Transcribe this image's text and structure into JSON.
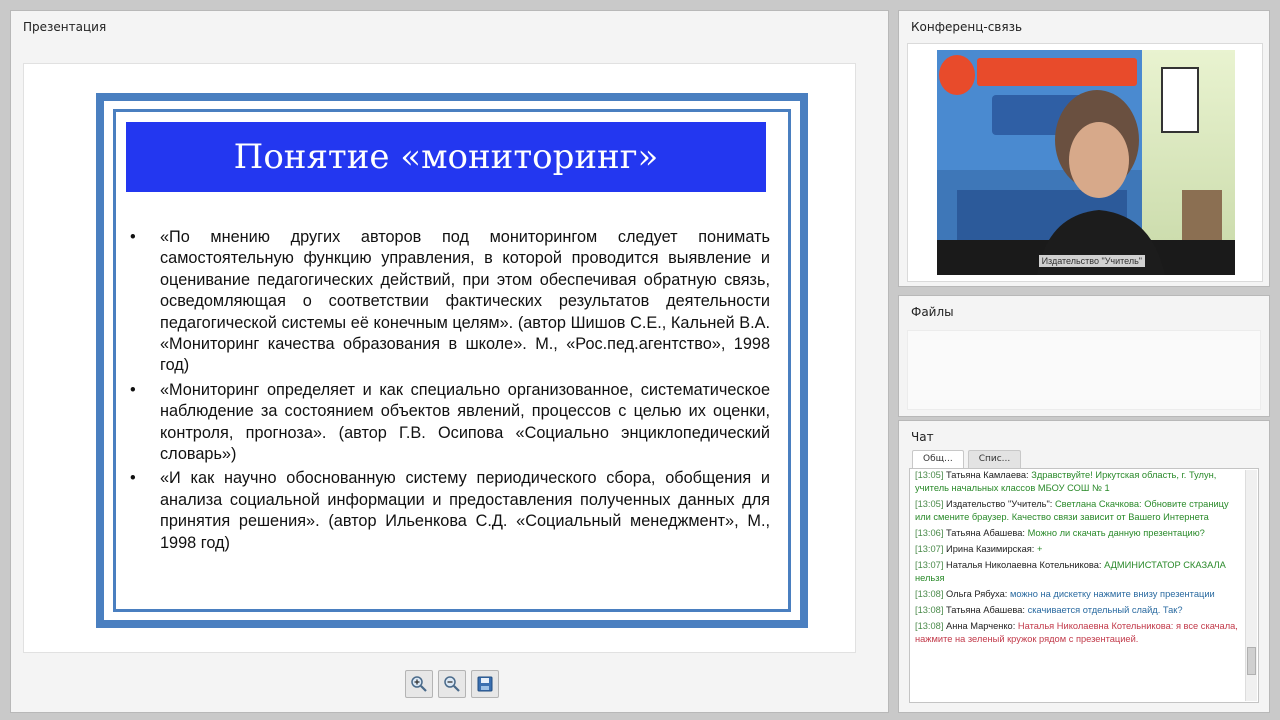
{
  "presentation": {
    "title": "Презентация",
    "slide": {
      "heading": "Понятие «мониторинг»",
      "bullets": [
        "«По мнению других авторов под мониторингом следует понимать самостоятельную функцию управления, в которой проводится выявление и оценивание педагогических действий, при этом обеспечивая обратную связь, осведомляющая о соответствии фактических результатов деятельности педагогической системы её конечным целям». (автор Шишов С.Е., Кальней В.А. «Мониторинг качества образования в школе». М., «Рос.пед.агентство», 1998 год)",
        "«Мониторинг определяет и как специально организованное, систематическое наблюдение за состоянием объектов явлений, процессов с целью их оценки, контроля, прогноза». (автор Г.В. Осипова «Социально энциклопедический словарь»)",
        "«И как научно обоснованную систему периодического сбора, обобщения и анализа социальной информации и предоставления полученных данных для принятия решения». (автор Ильенкова С.Д. «Социальный менеджмент», М., 1998 год)"
      ],
      "bullet_symbol": "•"
    },
    "toolbar": {
      "zoom_in_icon": "zoom-in-icon",
      "zoom_out_icon": "zoom-out-icon",
      "save_icon": "save-icon"
    }
  },
  "conference": {
    "title": "Конференц-связь",
    "video_label": "Издательство \"Учитель\""
  },
  "files": {
    "title": "Файлы"
  },
  "chat": {
    "title": "Чат",
    "tabs": [
      "Общ...",
      "Спис..."
    ],
    "messages": [
      {
        "time": "[13:05]",
        "author": "Татьяна Камлаева:",
        "text": " Здравствуйте! Иркутская область, г. Тулун, учитель начальных классов МБОУ СОШ № 1",
        "color": "green"
      },
      {
        "time": "[13:05]",
        "author": "Издательство \"Учитель\":",
        "text": " Светлана Скачкова: Обновите страницу или смените браузер. Качество связи зависит от Вашего Интернета",
        "color": "green"
      },
      {
        "time": "[13:06]",
        "author": "Татьяна Абашева:",
        "text": " Можно ли скачать данную презентацию?",
        "color": "green"
      },
      {
        "time": "[13:07]",
        "author": "Ирина Казимирская:",
        "text": " +",
        "color": "green"
      },
      {
        "time": "[13:07]",
        "author": "Наталья Николаевна Котельникова:",
        "text": " АДМИНИСТАТОР СКАЗАЛА нельзя",
        "color": "green"
      },
      {
        "time": "[13:08]",
        "author": "Ольга Рябуха:",
        "text": " можно на дискетку нажмите внизу презентации",
        "color": "blue"
      },
      {
        "time": "[13:08]",
        "author": "Татьяна Абашева:",
        "text": " скачивается отдельный слайд. Так?",
        "color": "blue"
      },
      {
        "time": "[13:08]",
        "author": "Анна Марченко:",
        "text": " Наталья Николаевна Котельникова: я все скачала, нажмите на зеленый кружок рядом с презентацией.",
        "color": "red"
      }
    ]
  }
}
